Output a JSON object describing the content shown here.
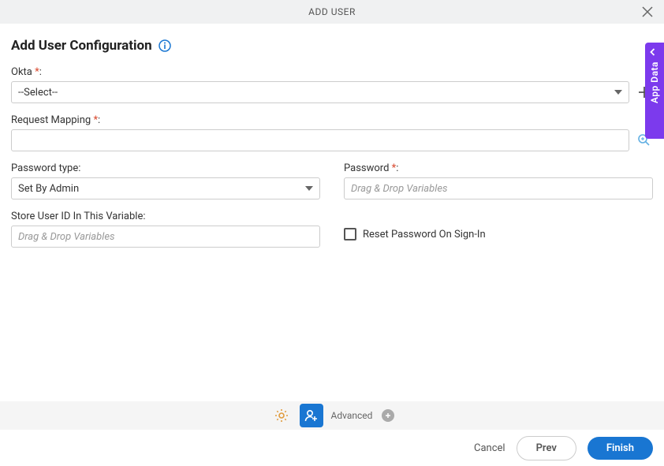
{
  "header": {
    "title": "ADD USER"
  },
  "page": {
    "title": "Add User Configuration"
  },
  "form": {
    "okta": {
      "label": "Okta",
      "value": "--Select--"
    },
    "requestMapping": {
      "label": "Request Mapping",
      "value": ""
    },
    "passwordType": {
      "label": "Password type:",
      "value": "Set By Admin"
    },
    "password": {
      "label": "Password",
      "placeholder": "Drag & Drop Variables",
      "value": ""
    },
    "storeUserId": {
      "label": "Store User ID In This Variable:",
      "placeholder": "Drag & Drop Variables",
      "value": ""
    },
    "resetPassword": {
      "label": "Reset Password On Sign-In",
      "checked": false
    }
  },
  "sidebar": {
    "appData": "App Data"
  },
  "tabBar": {
    "advanced": "Advanced"
  },
  "footer": {
    "cancel": "Cancel",
    "prev": "Prev",
    "finish": "Finish"
  }
}
